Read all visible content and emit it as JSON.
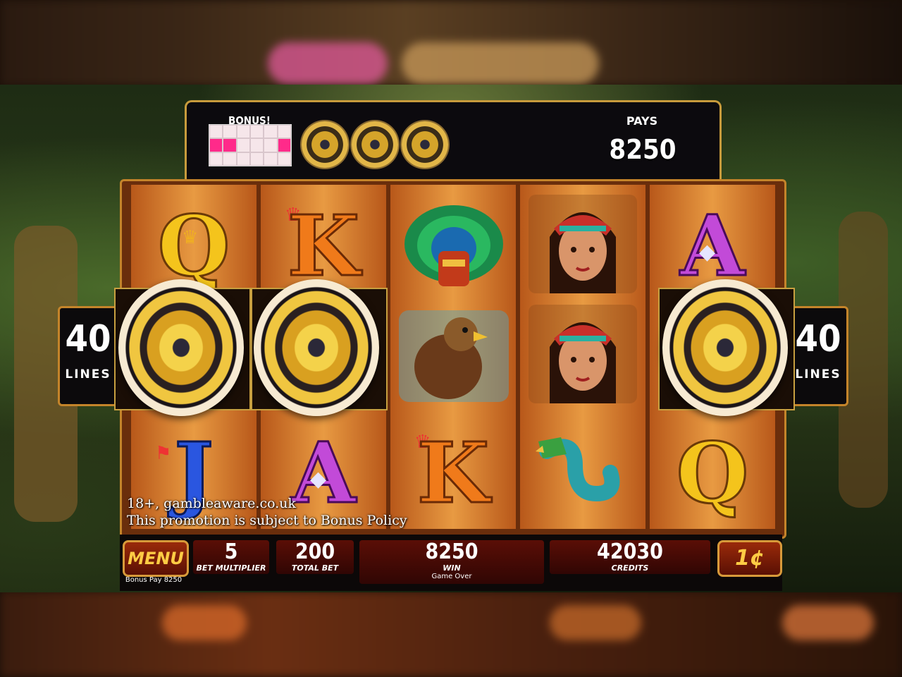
{
  "bonus_panel": {
    "title": "BONUS!",
    "grid_rows": 3,
    "grid_cols": 6,
    "lit_cells_row2": [
      0,
      1,
      5
    ],
    "pays_label": "PAYS",
    "pays_value": "8250"
  },
  "side_badges": {
    "left": {
      "number": "40",
      "word": "LINES"
    },
    "right": {
      "number": "40",
      "word": "LINES"
    }
  },
  "reels": [
    [
      "Q",
      "scatter-coin",
      "J"
    ],
    [
      "K",
      "scatter-coin",
      "A"
    ],
    [
      "headdress",
      "eagle",
      "K"
    ],
    [
      "princess",
      "princess",
      "serpent"
    ],
    [
      "A",
      "scatter-coin",
      "Q"
    ]
  ],
  "disclaimer": {
    "line1": "18+, gambleaware.co.uk",
    "line2": "This promotion is subject to Bonus Policy"
  },
  "bottom_bar": {
    "menu_label": "MENU",
    "bonus_pay": "Bonus Pay 8250",
    "bet_multiplier_value": "5",
    "bet_multiplier_label": "BET MULTIPLIER",
    "total_bet_value": "200",
    "total_bet_label": "TOTAL BET",
    "win_value": "8250",
    "win_label": "WIN",
    "win_status": "Game Over",
    "credits_value": "42030",
    "credits_label": "CREDITS",
    "denomination": "1¢"
  },
  "colors": {
    "frame_gold": "#c89b3c",
    "reel_orange": "#e89a42",
    "bonus_pink": "#ff2a8a",
    "field_red": "#5a0e06"
  }
}
